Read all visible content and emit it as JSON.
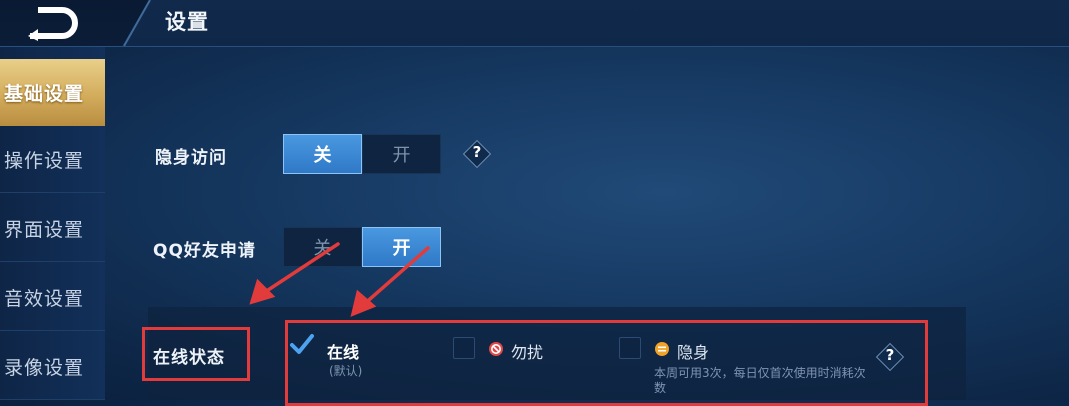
{
  "header": {
    "title": "设置"
  },
  "sidebar": {
    "items": [
      {
        "label": "基础设置",
        "active": true
      },
      {
        "label": "操作设置",
        "active": false
      },
      {
        "label": "界面设置",
        "active": false
      },
      {
        "label": "音效设置",
        "active": false
      },
      {
        "label": "录像设置",
        "active": false
      }
    ]
  },
  "settings": {
    "stealth_visit": {
      "label": "隐身访问",
      "off_label": "关",
      "on_label": "开",
      "selected": "关"
    },
    "qq_friend_request": {
      "label": "QQ好友申请",
      "off_label": "关",
      "on_label": "开",
      "selected": "开"
    },
    "online_status": {
      "label": "在线状态",
      "options": [
        {
          "label": "在线",
          "sub": "(默认)",
          "checked": true,
          "icon": "check-icon"
        },
        {
          "label": "勿扰",
          "checked": false,
          "icon": "do-not-disturb-icon"
        },
        {
          "label": "隐身",
          "sub": "本周可用3次，每日仅首次使用时消耗次数",
          "checked": false,
          "icon": "invisible-icon"
        }
      ]
    }
  },
  "colors": {
    "accent_blue": "#3a88d6",
    "active_tab_gold": "#d3ac5c",
    "annotation_red": "#e23b3b",
    "dnd_red": "#e04848",
    "invisible_orange": "#f0a326"
  }
}
